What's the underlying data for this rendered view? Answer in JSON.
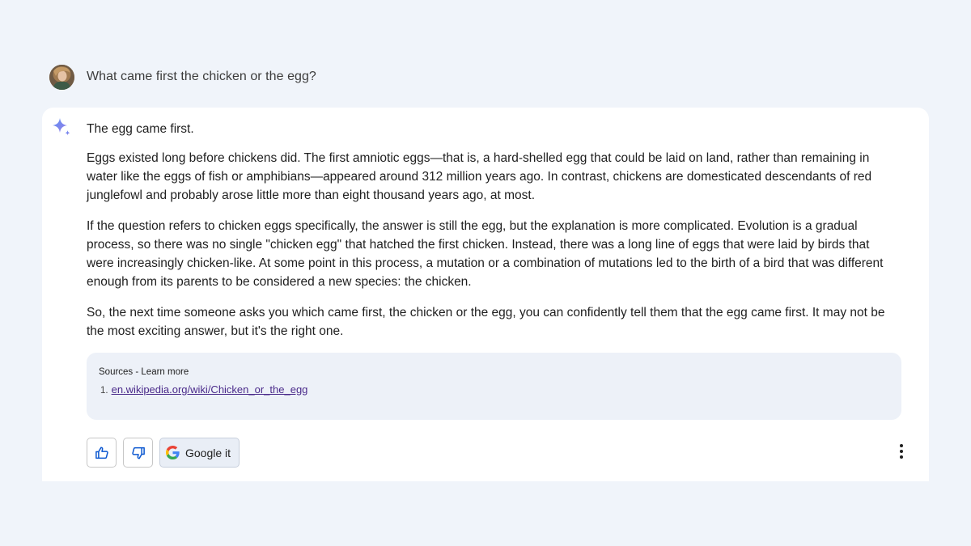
{
  "prompt": {
    "text": "What came first the chicken or the egg?"
  },
  "response": {
    "paragraphs": [
      "The egg came first.",
      "Eggs existed long before chickens did. The first amniotic eggs—that is, a hard-shelled egg that could be laid on land, rather than remaining in water like the eggs of fish or amphibians—appeared around 312 million years ago. In contrast, chickens are domesticated descendants of red junglefowl and probably arose little more than eight thousand years ago, at most.",
      "If the question refers to chicken eggs specifically, the answer is still the egg, but the explanation is more complicated. Evolution is a gradual process, so there was no single \"chicken egg\" that hatched the first chicken. Instead, there was a long line of eggs that were laid by birds that were increasingly chicken-like. At some point in this process, a mutation or a combination of mutations led to the birth of a bird that was different enough from its parents to be considered a new species: the chicken.",
      "So, the next time someone asks you which came first, the chicken or the egg, you can confidently tell them that the egg came first. It may not be the most exciting answer, but it's the right one."
    ]
  },
  "sources": {
    "title": "Sources - Learn more",
    "items": [
      {
        "number": "1.",
        "link": "en.wikipedia.org/wiki/Chicken_or_the_egg"
      }
    ]
  },
  "actions": {
    "google_label": "Google it"
  },
  "icons": {
    "sparkle": "sparkle-icon",
    "thumbs_up": "thumbs-up-icon",
    "thumbs_down": "thumbs-down-icon",
    "google": "google-g-icon",
    "more": "more-vertical-icon"
  },
  "colors": {
    "page_background": "#f0f4fa",
    "card_background": "#ffffff",
    "sources_background": "#edf1f8",
    "link": "#4a2a8a",
    "sparkle_blue": "#4b8df8"
  }
}
